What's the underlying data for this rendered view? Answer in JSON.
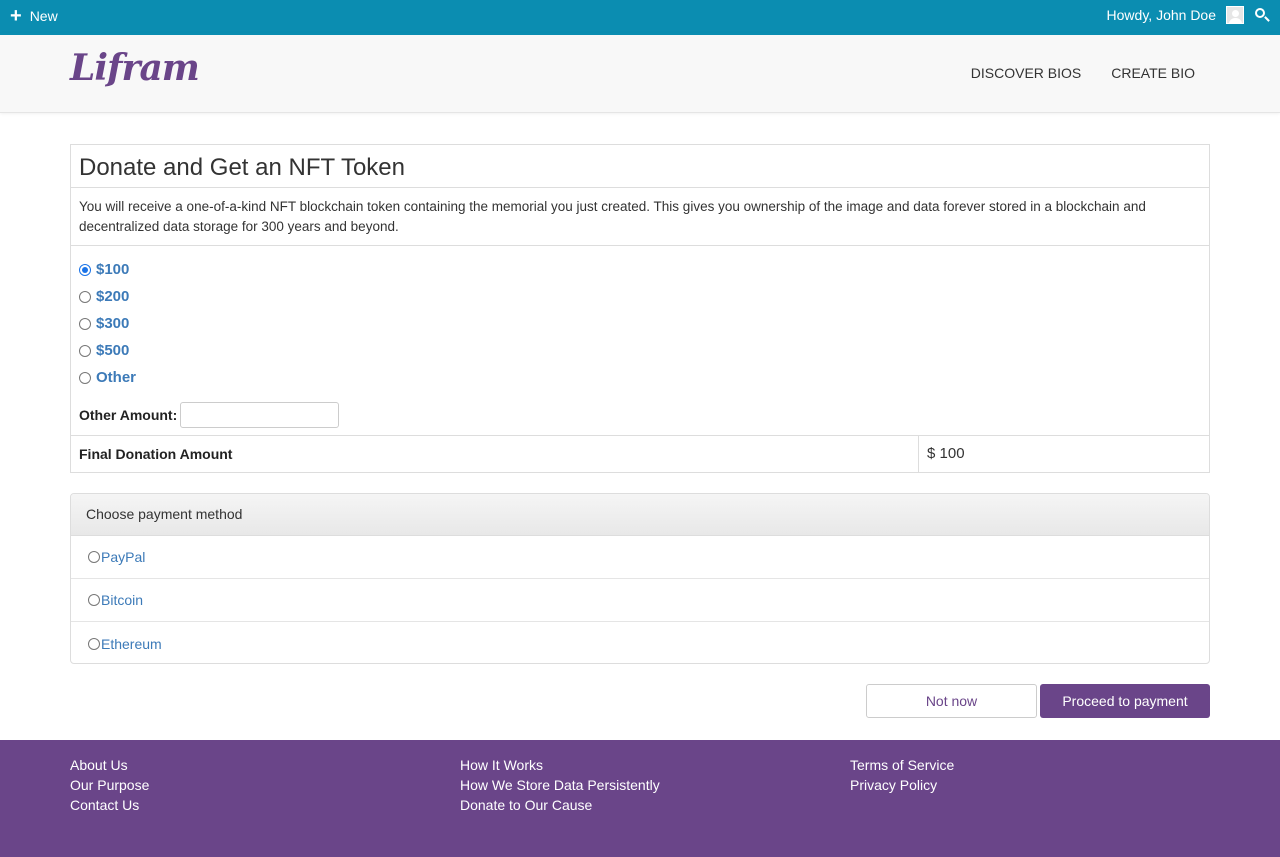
{
  "adminbar": {
    "new_label": "New",
    "greeting": "Howdy, John Doe"
  },
  "header": {
    "logo": "Lifram",
    "nav": [
      "DISCOVER BIOS",
      "CREATE BIO"
    ]
  },
  "donate": {
    "title": "Donate and Get an NFT Token",
    "description": "You will receive a one-of-a-kind NFT blockchain token containing the memorial you just created. This gives you ownership of the image and data forever stored in a blockchain and decentralized data storage for 300 years and beyond.",
    "amounts": [
      "$100",
      "$200",
      "$300",
      "$500",
      "Other"
    ],
    "selected_amount": "$100",
    "other_amount_label": "Other Amount:",
    "other_amount_value": "",
    "final_label": "Final Donation Amount",
    "final_value": "$ 100"
  },
  "payment": {
    "header": "Choose payment method",
    "methods": [
      "PayPal",
      "Bitcoin",
      "Ethereum"
    ]
  },
  "actions": {
    "not_now": "Not now",
    "proceed": "Proceed to payment"
  },
  "footer": {
    "col1": [
      "About Us",
      "Our Purpose",
      "Contact Us"
    ],
    "col2": [
      "How It Works",
      "How We Store Data Persistently",
      "Donate to Our Cause"
    ],
    "col3": [
      "Terms of Service",
      "Privacy Policy"
    ]
  },
  "colors": {
    "adminbar": "#0b8db1",
    "brand": "#6a4589",
    "link": "#3c7ab8"
  }
}
